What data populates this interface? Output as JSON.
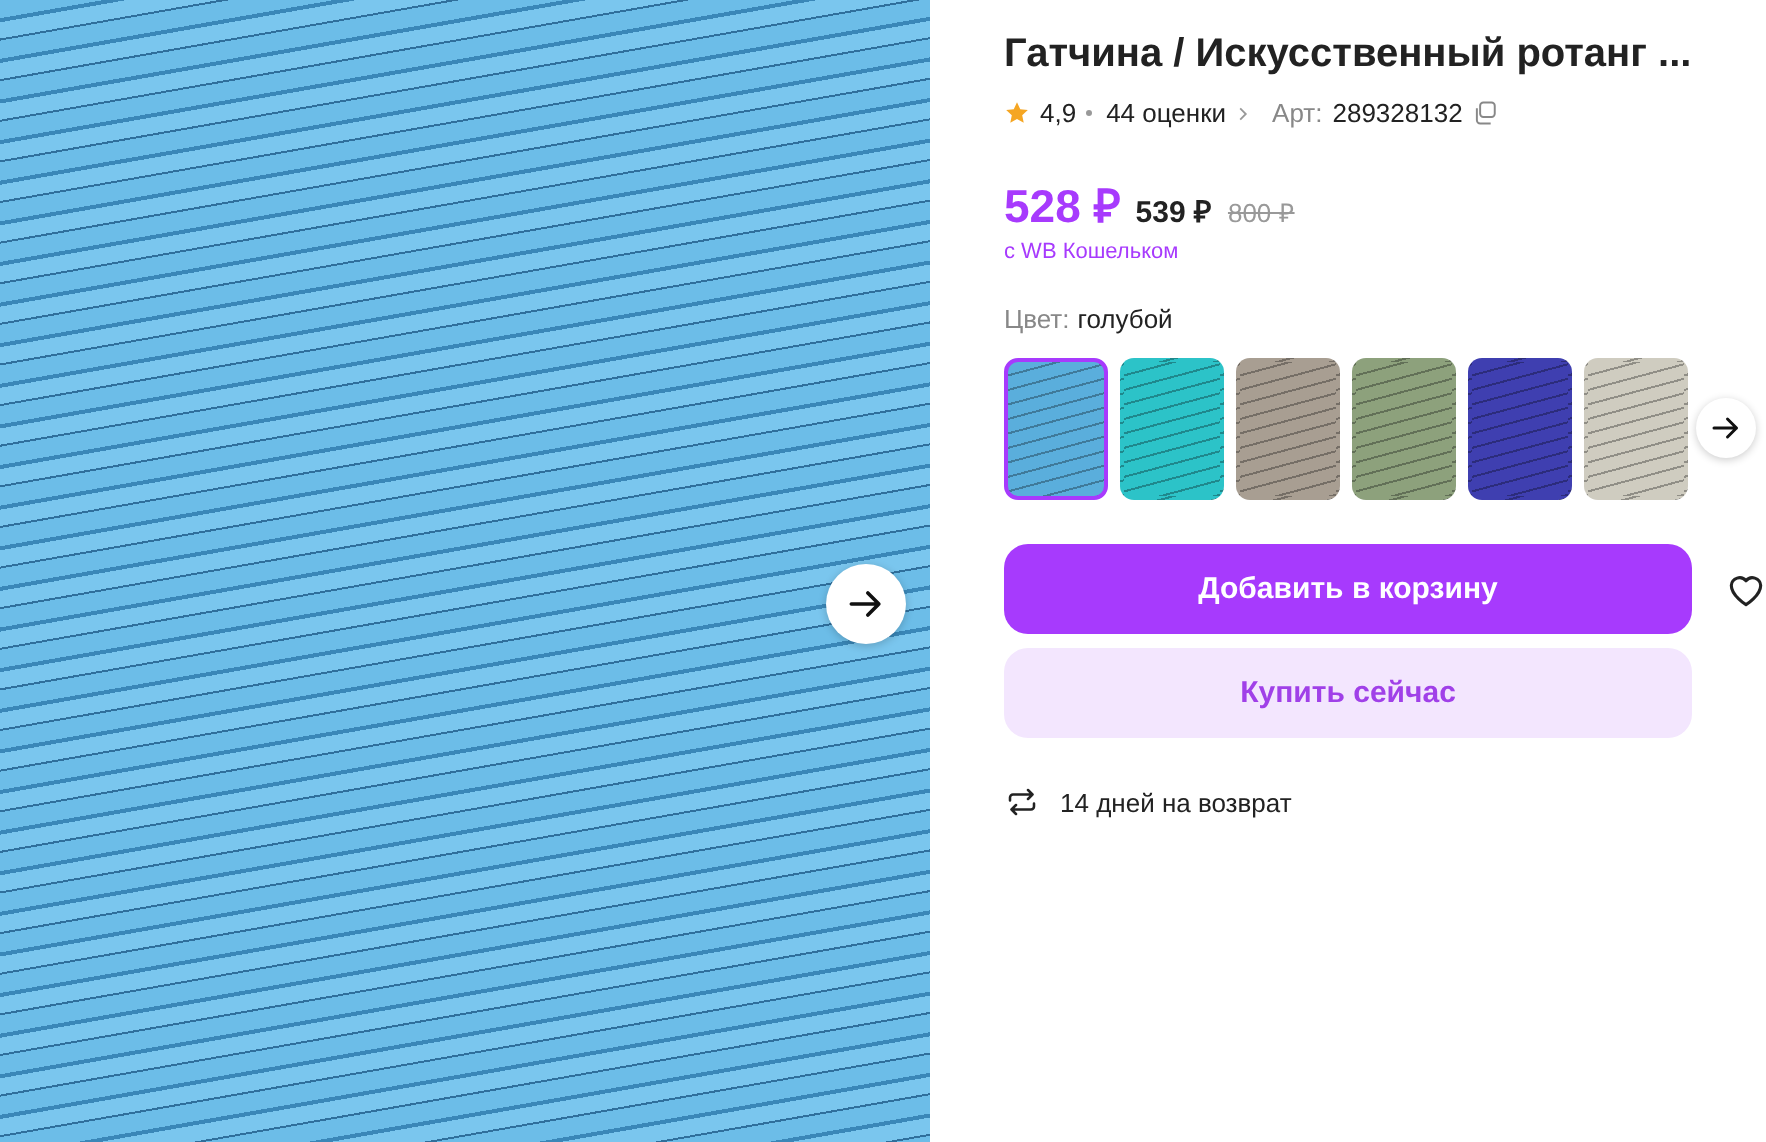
{
  "product": {
    "title": "Гатчина / Искусственный ротанг ...",
    "rating": "4,9",
    "reviews": "44 оценки",
    "article_label": "Арт:",
    "article": "289328132"
  },
  "price": {
    "current": "528 ₽",
    "wallet_price": "539 ₽",
    "old": "800 ₽",
    "note": "с WB Кошельком"
  },
  "color_picker": {
    "label": "Цвет:",
    "value": "голубой",
    "swatches": [
      {
        "color": "#5aaedc",
        "selected": true
      },
      {
        "color": "#2cc3c8",
        "selected": false
      },
      {
        "color": "#a89e92",
        "selected": false
      },
      {
        "color": "#8da17c",
        "selected": false
      },
      {
        "color": "#3f3fb0",
        "selected": false
      },
      {
        "color": "#cfccc0",
        "selected": false
      }
    ]
  },
  "buttons": {
    "add_to_cart": "Добавить в корзину",
    "buy_now": "Купить сейчас"
  },
  "returns": "14 дней на возврат"
}
